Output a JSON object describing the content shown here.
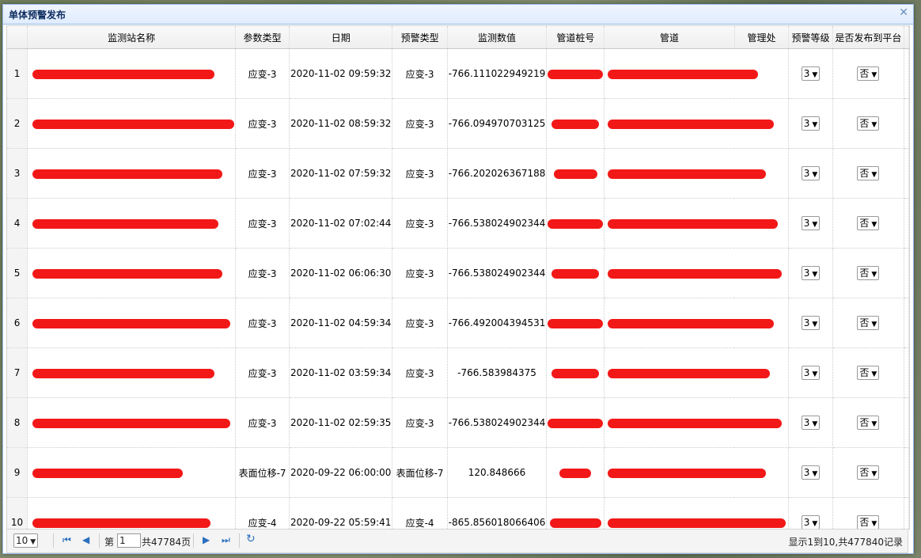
{
  "window": {
    "title": "单体预警发布"
  },
  "columns": [
    "监测站名称",
    "参数类型",
    "日期",
    "预警类型",
    "监测数值",
    "管道桩号",
    "管道",
    "管理处",
    "预警等级",
    "是否发布到平台"
  ],
  "rows": [
    {
      "no": "1",
      "param": "应变-3",
      "date": "2020-11-02 09:59:32",
      "alarm": "应变-3",
      "value": "-766.111022949219",
      "level": "3",
      "publish": "否"
    },
    {
      "no": "2",
      "param": "应变-3",
      "date": "2020-11-02 08:59:32",
      "alarm": "应变-3",
      "value": "-766.094970703125",
      "level": "3",
      "publish": "否"
    },
    {
      "no": "3",
      "param": "应变-3",
      "date": "2020-11-02 07:59:32",
      "alarm": "应变-3",
      "value": "-766.202026367188",
      "level": "3",
      "publish": "否"
    },
    {
      "no": "4",
      "param": "应变-3",
      "date": "2020-11-02 07:02:44",
      "alarm": "应变-3",
      "value": "-766.538024902344",
      "level": "3",
      "publish": "否"
    },
    {
      "no": "5",
      "param": "应变-3",
      "date": "2020-11-02 06:06:30",
      "alarm": "应变-3",
      "value": "-766.538024902344",
      "level": "3",
      "publish": "否"
    },
    {
      "no": "6",
      "param": "应变-3",
      "date": "2020-11-02 04:59:34",
      "alarm": "应变-3",
      "value": "-766.492004394531",
      "level": "3",
      "publish": "否"
    },
    {
      "no": "7",
      "param": "应变-3",
      "date": "2020-11-02 03:59:34",
      "alarm": "应变-3",
      "value": "-766.583984375",
      "level": "3",
      "publish": "否"
    },
    {
      "no": "8",
      "param": "应变-3",
      "date": "2020-11-02 02:59:35",
      "alarm": "应变-3",
      "value": "-766.538024902344",
      "level": "3",
      "publish": "否"
    },
    {
      "no": "9",
      "param": "表面位移-7",
      "date": "2020-09-22 06:00:00",
      "alarm": "表面位移-7",
      "value": "120.848666",
      "level": "3",
      "publish": "否"
    },
    {
      "no": "10",
      "param": "应变-4",
      "date": "2020-09-22 05:59:41",
      "alarm": "应变-4",
      "value": "-865.856018066406",
      "level": "3",
      "publish": "否"
    }
  ],
  "pager": {
    "page_size": "10",
    "page_prefix": "第",
    "current_page": "1",
    "total_pages": "共47784页",
    "info": "显示1到10,共477840记录"
  },
  "icons": {
    "first": "first-page-icon",
    "prev": "prev-page-icon",
    "next": "next-page-icon",
    "last": "last-page-icon",
    "refresh": "refresh-icon",
    "close": "close-icon"
  },
  "colors": {
    "redaction": "#f21818",
    "title_bg": "#e0ecff",
    "border": "#95b8e7",
    "pager_icon": "#2a6fbe"
  }
}
